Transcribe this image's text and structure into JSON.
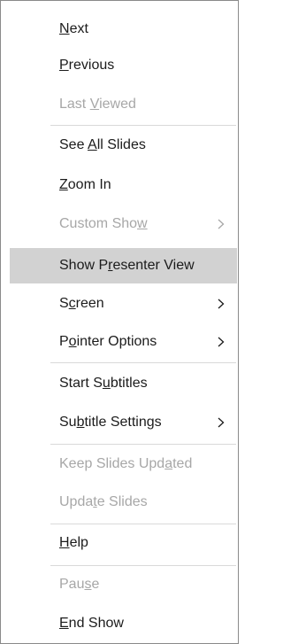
{
  "menu": {
    "items": [
      {
        "label": "Next",
        "mnemonic": 0,
        "enabled": true,
        "highlighted": false,
        "submenu": false
      },
      {
        "label": "Previous",
        "mnemonic": 0,
        "enabled": true,
        "highlighted": false,
        "submenu": false
      },
      {
        "label": "Last Viewed",
        "mnemonic": 5,
        "enabled": false,
        "highlighted": false,
        "submenu": false
      },
      {
        "label": "See All Slides",
        "mnemonic": 4,
        "enabled": true,
        "highlighted": false,
        "submenu": false
      },
      {
        "label": "Zoom In",
        "mnemonic": 0,
        "enabled": true,
        "highlighted": false,
        "submenu": false
      },
      {
        "label": "Custom Show",
        "mnemonic": 10,
        "enabled": false,
        "highlighted": false,
        "submenu": true
      },
      {
        "label": "Show Presenter View",
        "mnemonic": 6,
        "enabled": true,
        "highlighted": true,
        "submenu": false
      },
      {
        "label": "Screen",
        "mnemonic": 1,
        "enabled": true,
        "highlighted": false,
        "submenu": true
      },
      {
        "label": "Pointer Options",
        "mnemonic": 1,
        "enabled": true,
        "highlighted": false,
        "submenu": true
      },
      {
        "label": "Start Subtitles",
        "mnemonic": 7,
        "enabled": true,
        "highlighted": false,
        "submenu": false
      },
      {
        "label": "Subtitle Settings",
        "mnemonic": 2,
        "enabled": true,
        "highlighted": false,
        "submenu": true
      },
      {
        "label": "Keep Slides Updated",
        "mnemonic": 15,
        "enabled": false,
        "highlighted": false,
        "submenu": false
      },
      {
        "label": "Update Slides",
        "mnemonic": 4,
        "enabled": false,
        "highlighted": false,
        "submenu": false
      },
      {
        "label": "Help",
        "mnemonic": 0,
        "enabled": true,
        "highlighted": false,
        "submenu": false
      },
      {
        "label": "Pause",
        "mnemonic": 3,
        "enabled": false,
        "highlighted": false,
        "submenu": false
      },
      {
        "label": "End Show",
        "mnemonic": 0,
        "enabled": true,
        "highlighted": false,
        "submenu": false
      }
    ]
  },
  "colors": {
    "text": "#1b1b1b",
    "disabled_text": "#a7a7a7",
    "highlight_bg": "#d2d2d2",
    "separator": "#d9d9d9",
    "border": "#8a8a8a"
  }
}
